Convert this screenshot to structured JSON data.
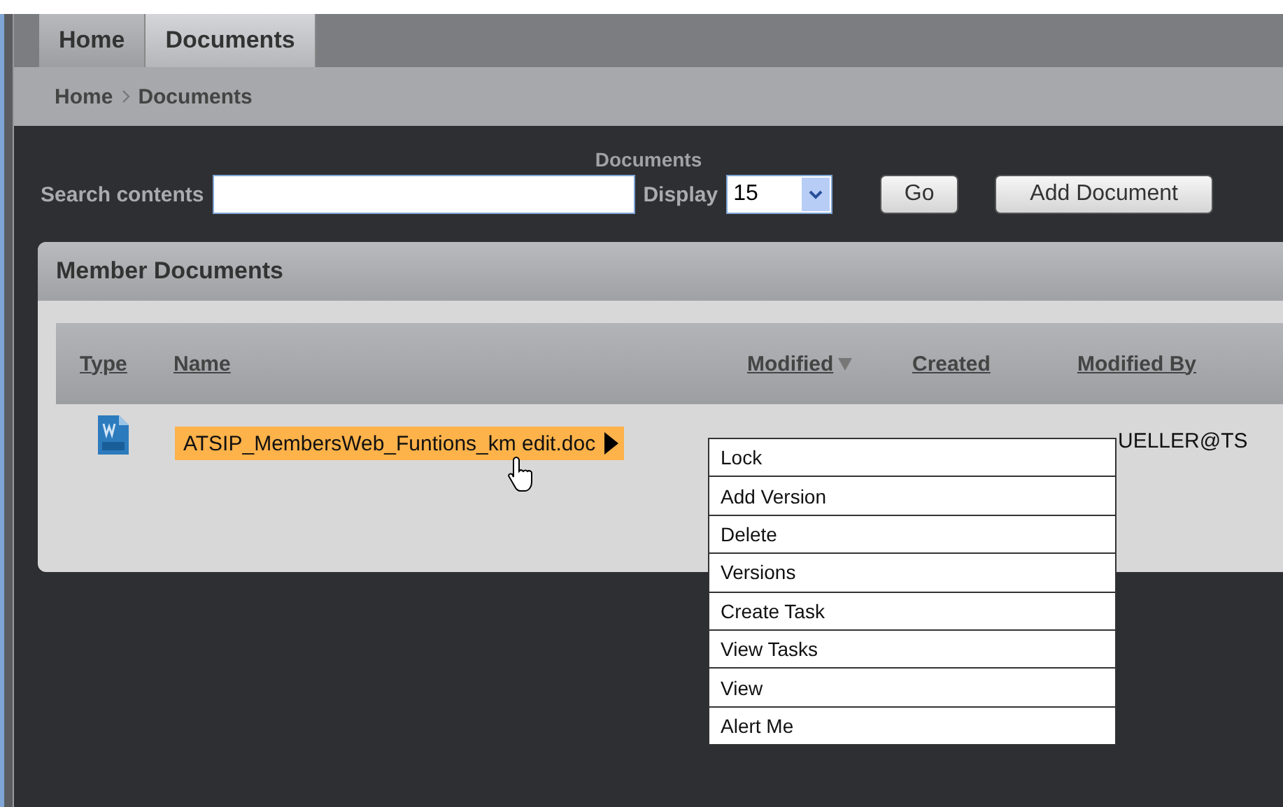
{
  "tabs": [
    {
      "label": "Home",
      "selected": false
    },
    {
      "label": "Documents",
      "selected": true
    }
  ],
  "breadcrumb": [
    "Home",
    "Documents"
  ],
  "toolbar": {
    "title": "Documents",
    "search_label": "Search contents",
    "display_label": "Display",
    "display_value": "15",
    "buttons": [
      "Go",
      "Add Document"
    ]
  },
  "panel": {
    "title": "Member Documents",
    "columns": [
      {
        "label": "Type",
        "sorted": false
      },
      {
        "label": "Name",
        "sorted": false
      },
      {
        "label": "Modified",
        "sorted": true
      },
      {
        "label": "Created",
        "sorted": false
      },
      {
        "label": "Modified By",
        "sorted": false
      }
    ],
    "rows": [
      {
        "name": "ATSIP_MembersWeb_Funtions_km edit.doc",
        "modified_by": "UELLER@TS",
        "highlighted": true
      }
    ]
  },
  "context_menu": [
    "Lock",
    "Add Version",
    "Delete",
    "Versions",
    "Create Task",
    "View Tasks",
    "View",
    "Alert Me"
  ]
}
